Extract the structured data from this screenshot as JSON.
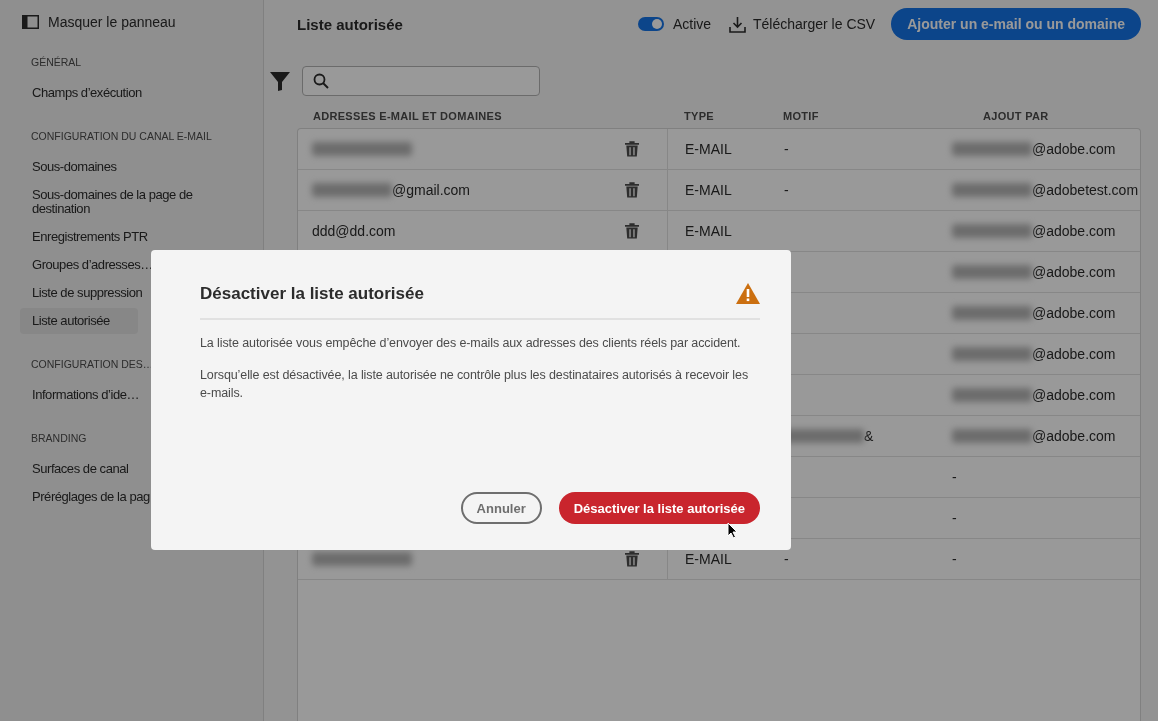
{
  "sidebar": {
    "hide_panel": "Masquer le panneau",
    "sections": [
      {
        "title": "GÉNÉRAL",
        "items": [
          {
            "label": "Champs d’exécution",
            "selected": false
          }
        ]
      },
      {
        "title": "CONFIGURATION DU CANAL E-MAIL",
        "items": [
          {
            "label": "Sous-domaines",
            "selected": false
          },
          {
            "label": "Sous-domaines de la page de destination",
            "selected": false
          },
          {
            "label": "Enregistrements PTR",
            "selected": false
          },
          {
            "label": "Groupes d’adresses…",
            "selected": false
          },
          {
            "label": "Liste de suppression",
            "selected": false
          },
          {
            "label": "Liste autorisée",
            "selected": true
          }
        ]
      },
      {
        "title": "CONFIGURATION DES…",
        "items": [
          {
            "label": "Informations d’ide…",
            "selected": false
          }
        ]
      },
      {
        "title": "BRANDING",
        "items": [
          {
            "label": "Surfaces de canal",
            "selected": false
          },
          {
            "label": "Préréglages de la pag",
            "selected": false
          }
        ]
      }
    ]
  },
  "header": {
    "title": "Liste autorisée",
    "toggle": {
      "label": "Active",
      "on": true
    },
    "download": "Télécharger le CSV",
    "add_button": "Ajouter un e-mail ou un domaine"
  },
  "table": {
    "columns": [
      "ADRESSES E-MAIL ET DOMAINES",
      "TYPE",
      "MOTIF",
      "AJOUT PAR"
    ],
    "rows": [
      {
        "email": {
          "blurred": true
        },
        "delete": true,
        "type": "E-MAIL",
        "motif": {
          "text": "-"
        },
        "added_by": {
          "blurred": true,
          "text": "@adobe.com"
        }
      },
      {
        "email": {
          "blurred": true,
          "text": "@gmail.com"
        },
        "delete": true,
        "type": "E-MAIL",
        "motif": {
          "text": "-"
        },
        "added_by": {
          "blurred": true,
          "text": "@adobetest.com"
        }
      },
      {
        "email": {
          "blurred": false,
          "text": "ddd@dd.com"
        },
        "delete": true,
        "type": "E-MAIL",
        "added_by": {
          "blurred": true,
          "text": "@adobe.com"
        }
      },
      {
        "added_by": {
          "blurred": true,
          "text": "@adobe.com"
        }
      },
      {
        "added_by": {
          "blurred": true,
          "text": "@adobe.com"
        }
      },
      {
        "added_by": {
          "blurred": true,
          "text": "@adobe.com"
        }
      },
      {
        "added_by": {
          "blurred": true,
          "text": "@adobe.com"
        }
      },
      {
        "motif": {
          "blurred": true,
          "text": "&"
        },
        "added_by": {
          "blurred": true,
          "text": "@adobe.com"
        }
      },
      {
        "added_by": {
          "blurred": false,
          "text": "-"
        }
      },
      {
        "added_by": {
          "blurred": false,
          "text": "-"
        }
      },
      {
        "email": {
          "blurred": true
        },
        "delete": true,
        "type": "E-MAIL",
        "motif": {
          "text": "-"
        },
        "added_by": {
          "blurred": false,
          "text": "-"
        }
      }
    ]
  },
  "dialog": {
    "title": "Désactiver la liste autorisée",
    "paragraphs": [
      "La liste autorisée vous empêche d’envoyer des e-mails aux adresses des clients réels par accident.",
      "Lorsqu’elle est désactivée, la liste autorisée ne contrôle plus les destinataires autorisés à recevoir les e-mails."
    ],
    "buttons": [
      {
        "label": "Annuler",
        "kind": "secondary"
      },
      {
        "label": "Désactiver la liste autorisée",
        "kind": "negative"
      }
    ]
  }
}
